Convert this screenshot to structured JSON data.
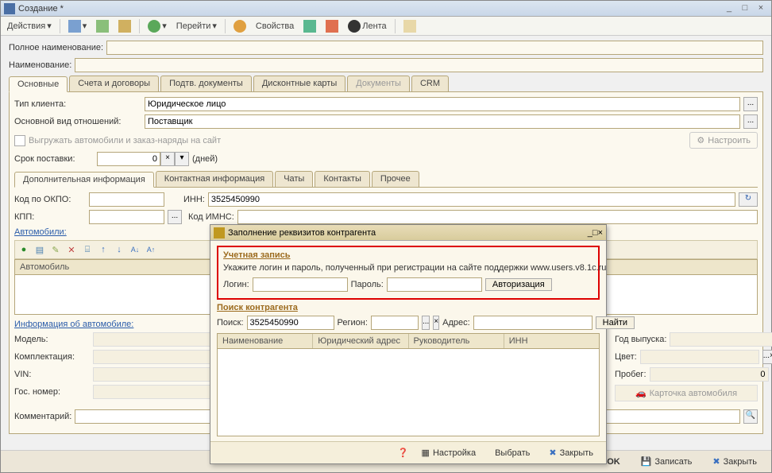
{
  "win": {
    "title": "Создание *"
  },
  "toolbar": {
    "actions": "Действия",
    "goto": "Перейти",
    "props": "Свойства",
    "feed": "Лента"
  },
  "fields": {
    "fullname_lbl": "Полное наименование:",
    "name_lbl": "Наименование:",
    "client_type_lbl": "Тип клиента:",
    "client_type_val": "Юридическое лицо",
    "main_rel_lbl": "Основной вид отношений:",
    "main_rel_val": "Поставщик",
    "export_chk": "Выгружать автомобили и заказ-наряды на сайт",
    "setup_btn": "Настроить",
    "delivery_lbl": "Срок поставки:",
    "delivery_val": "0",
    "delivery_unit": "(дней)",
    "okpo_lbl": "Код по ОКПО:",
    "inn_lbl": "ИНН:",
    "inn_val": "3525450990",
    "kpp_lbl": "КПП:",
    "imns_lbl": "Код ИМНС:",
    "auto_section": "Автомобили:",
    "auto_col": "Автомобиль",
    "carinfo": "Информация об автомобиле:",
    "model_lbl": "Модель:",
    "kompl_lbl": "Комплектация:",
    "vin_lbl": "VIN:",
    "gos_lbl": "Гос. номер:",
    "year_lbl": "Год выпуска:",
    "color_lbl": "Цвет:",
    "mileage_lbl": "Пробег:",
    "mileage_val": "0",
    "card_btn": "Карточка автомобиля",
    "comment_lbl": "Комментарий:"
  },
  "main_tabs": [
    "Основные",
    "Счета и договоры",
    "Подтв. документы",
    "Дисконтные карты",
    "Документы",
    "CRM"
  ],
  "sub_tabs": [
    "Дополнительная информация",
    "Контактная информация",
    "Чаты",
    "Контакты",
    "Прочее"
  ],
  "footer": {
    "ok": "OK",
    "save": "Записать",
    "close": "Закрыть"
  },
  "dialog": {
    "title": "Заполнение реквизитов контрагента",
    "acct": "Учетная запись",
    "hint": "Укажите логин и пароль, полученный при регистрации на сайте поддержки www.users.v8.1c.ru",
    "login_lbl": "Логин:",
    "pass_lbl": "Пароль:",
    "auth_btn": "Авторизация",
    "search_hd": "Поиск контрагента",
    "search_lbl": "Поиск:",
    "search_val": "3525450990",
    "region_lbl": "Регион:",
    "addr_lbl": "Адрес:",
    "find_btn": "Найти",
    "cols": [
      "Наименование",
      "Юридический адрес",
      "Руководитель",
      "ИНН"
    ],
    "cfg": "Настройка",
    "choose": "Выбрать",
    "close": "Закрыть"
  }
}
